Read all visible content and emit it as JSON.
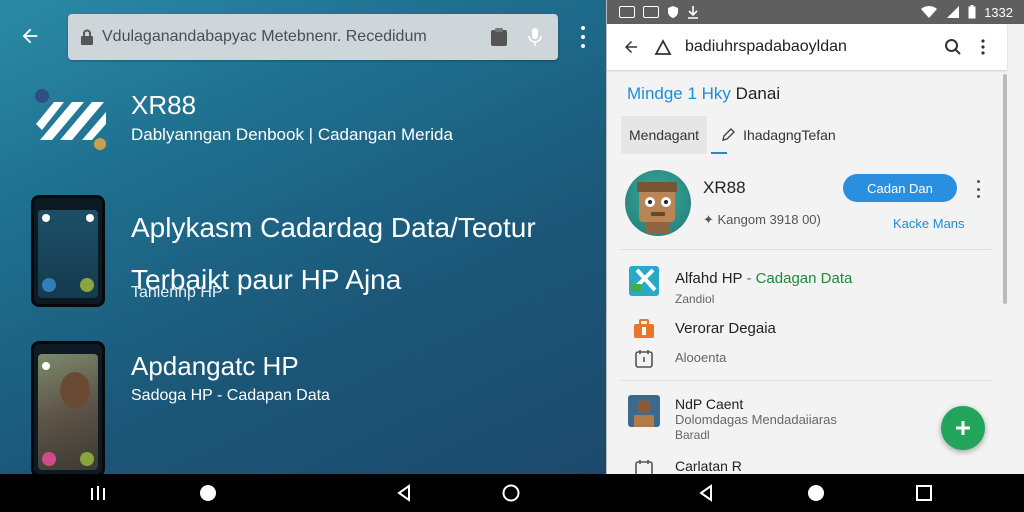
{
  "left": {
    "url": "Vdulaganandabapyac Metebnenr. Recedidum",
    "app": {
      "name": "XR88",
      "subtitle": "Dablyanngan Denbook | Cadangan Merida"
    },
    "headline": {
      "line1": "Aplykasm Cadardag Data/Teotur",
      "line2": "Terbaikt paur HP Ajna"
    },
    "tagline": "Tanlenhp HP",
    "section2": {
      "title": "Apdangatc HP",
      "subtitle": "Sadoga HP - Cadapan Data"
    },
    "icons": {
      "back": "arrow-left-icon",
      "lock": "lock-icon",
      "clipboard": "clipboard-icon",
      "mic": "mic-icon",
      "menu": "more-vert-icon"
    }
  },
  "right": {
    "status": {
      "time": "1332"
    },
    "toolbar": {
      "title": "badiuhrspadabaoyldan"
    },
    "section_title": {
      "accent": "Mindge 1 Hky",
      "rest": "Danai"
    },
    "tabs": [
      {
        "label": "Mendagant"
      },
      {
        "label": "IhadagngTefan"
      }
    ],
    "card": {
      "name": "XR88",
      "meta": "Kangom 3918 00)",
      "button": "Cadan Dan",
      "link": "Kacke Mans"
    },
    "items": [
      {
        "title": "Alfahd HP",
        "title_highlight": "- Cadagan Data",
        "sub": "Zandiol"
      },
      {
        "title": "Verorar Degaia",
        "title_highlight": "",
        "sub": ""
      },
      {
        "title": "",
        "title_highlight": "",
        "sub": "Alooenta"
      },
      {
        "title": "NdP Caent",
        "title_highlight": "",
        "sub": "Dolomdagas Mendadaiiaras",
        "sub2": "Baradl"
      },
      {
        "title": "Carlatan R",
        "title_highlight": "",
        "sub": ""
      }
    ]
  },
  "colors": {
    "accent_blue": "#2b8fe0",
    "fab_green": "#22a45a",
    "highlight_green": "#1f8a3a"
  }
}
